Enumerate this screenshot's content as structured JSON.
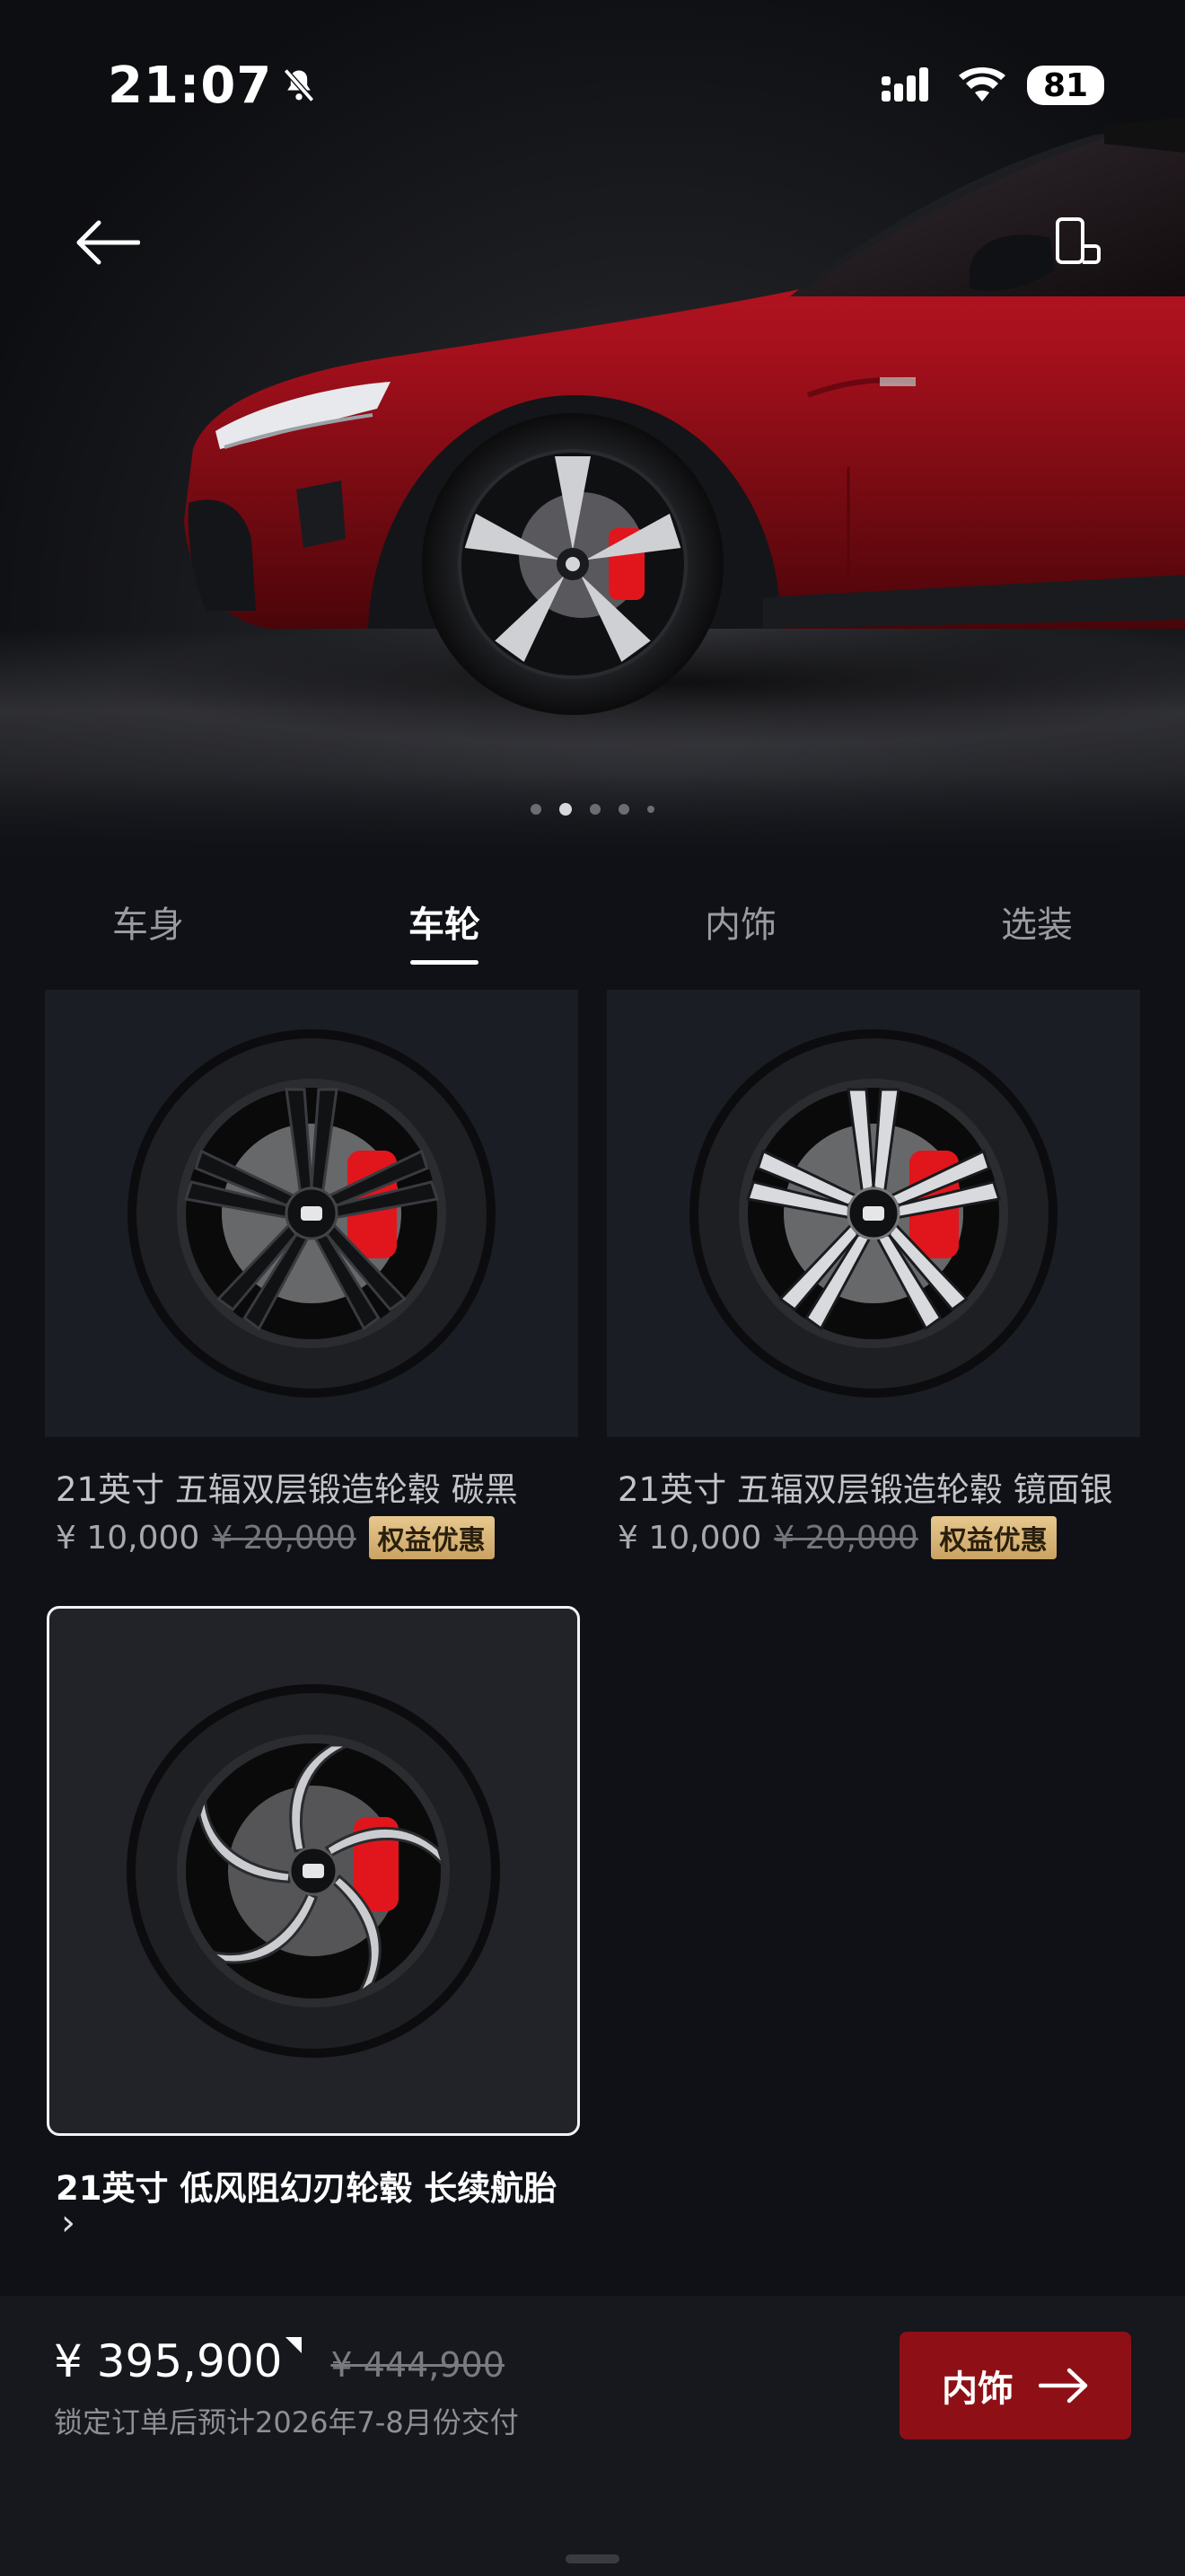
{
  "status_bar": {
    "time": "21:07",
    "battery": "81"
  },
  "hero": {
    "body_color": "#b0101e",
    "caliper_color": "#e0161c",
    "carousel_total": 5,
    "carousel_active_index": 1
  },
  "tabs": [
    {
      "label": "车身"
    },
    {
      "label": "车轮"
    },
    {
      "label": "内饰"
    },
    {
      "label": "选装"
    }
  ],
  "active_tab": "车轮",
  "wheels": [
    {
      "title": "21英寸 五辐双层锻造轮毂 碳黑",
      "price": "¥ 10,000",
      "original_price": "¥ 20,000",
      "badge": "权益优惠"
    },
    {
      "title": "21英寸 五辐双层锻造轮毂 镜面银",
      "price": "¥ 10,000",
      "original_price": "¥ 20,000",
      "badge": "权益优惠"
    },
    {
      "title": "21英寸 低风阻幻刃轮毂 长续航胎",
      "selected": true
    }
  ],
  "footer": {
    "total_price": "¥ 395,900",
    "original_total": "¥ 444,900",
    "delivery": "锁定订单后预计2026年7-8月份交付",
    "next_label": "内饰"
  }
}
